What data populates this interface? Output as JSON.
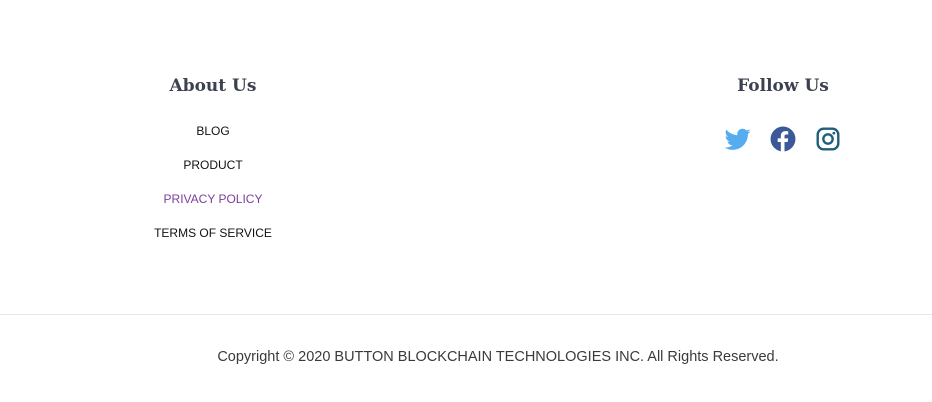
{
  "about": {
    "heading": "About Us",
    "links": [
      {
        "label": "BLOG"
      },
      {
        "label": "PRODUCT"
      },
      {
        "label": "PRIVACY POLICY"
      },
      {
        "label": "TERMS OF SERVICE"
      }
    ]
  },
  "follow": {
    "heading": "Follow Us",
    "icons": [
      "twitter-icon",
      "facebook-icon",
      "instagram-icon"
    ]
  },
  "colors": {
    "heading": "#3b4151",
    "link": "#111111",
    "link_active": "#7b3e9a",
    "twitter": "#55acee",
    "facebook": "#3b5998",
    "instagram": "#1f5f7a",
    "divider": "#e6e6e6",
    "copyright": "#3a3a3a"
  },
  "footer": {
    "copyright": "Copyright © 2020 BUTTON BLOCKCHAIN TECHNOLOGIES INC. All Rights Reserved."
  }
}
